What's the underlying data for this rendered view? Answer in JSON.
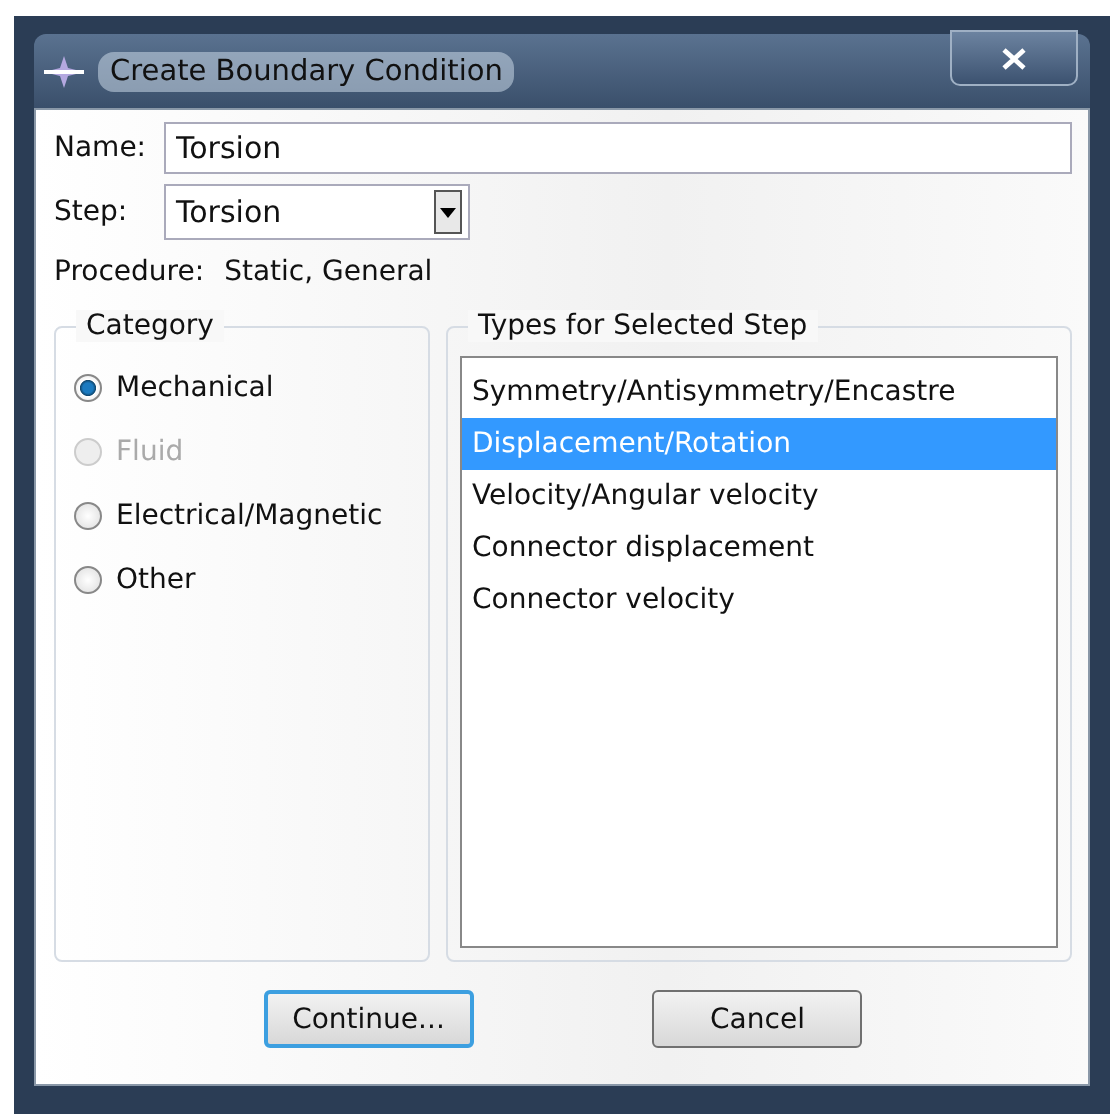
{
  "window": {
    "title": "Create Boundary Condition"
  },
  "name": {
    "label": "Name:",
    "value": "Torsion"
  },
  "step": {
    "label": "Step:",
    "value": "Torsion"
  },
  "procedure": {
    "label": "Procedure:",
    "value": "Static, General"
  },
  "category": {
    "title": "Category",
    "options": [
      {
        "label": "Mechanical",
        "selected": true,
        "disabled": false
      },
      {
        "label": "Fluid",
        "selected": false,
        "disabled": true
      },
      {
        "label": "Electrical/Magnetic",
        "selected": false,
        "disabled": false
      },
      {
        "label": "Other",
        "selected": false,
        "disabled": false
      }
    ]
  },
  "types": {
    "title": "Types for Selected Step",
    "items": [
      {
        "label": "Symmetry/Antisymmetry/Encastre",
        "selected": false
      },
      {
        "label": "Displacement/Rotation",
        "selected": true
      },
      {
        "label": "Velocity/Angular velocity",
        "selected": false
      },
      {
        "label": "Connector displacement",
        "selected": false
      },
      {
        "label": "Connector velocity",
        "selected": false
      }
    ]
  },
  "buttons": [
    {
      "label": "Continue...",
      "default": true
    },
    {
      "label": "Cancel",
      "default": false
    }
  ]
}
